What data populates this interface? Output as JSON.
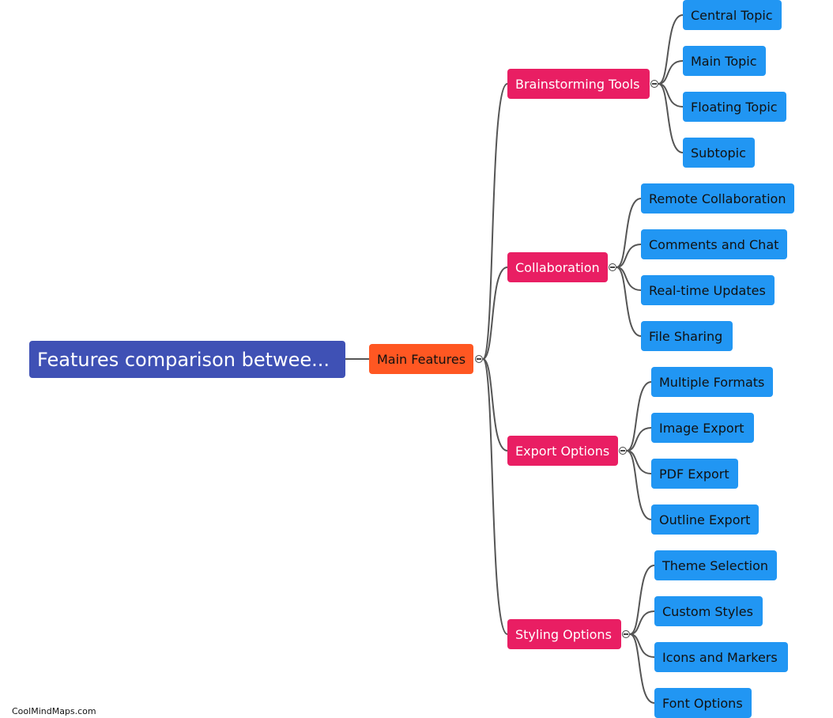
{
  "root": {
    "label": "Features comparison betwee..."
  },
  "main": {
    "label": "Main Features"
  },
  "branches": [
    {
      "label": "Brainstorming Tools",
      "children": [
        "Central Topic",
        "Main Topic",
        "Floating Topic",
        "Subtopic"
      ]
    },
    {
      "label": "Collaboration",
      "children": [
        "Remote Collaboration",
        "Comments and Chat",
        "Real-time Updates",
        "File Sharing"
      ]
    },
    {
      "label": "Export Options",
      "children": [
        "Multiple Formats",
        "Image Export",
        "PDF Export",
        "Outline Export"
      ]
    },
    {
      "label": "Styling Options",
      "children": [
        "Theme Selection",
        "Custom Styles",
        "Icons and Markers",
        "Font Options"
      ]
    }
  ],
  "colors": {
    "root": "#3f51b5",
    "main": "#ff5722",
    "branch": "#e91e63",
    "leaf": "#2196f3",
    "link": "#555555"
  },
  "footer": {
    "credit": "CoolMindMaps.com"
  }
}
